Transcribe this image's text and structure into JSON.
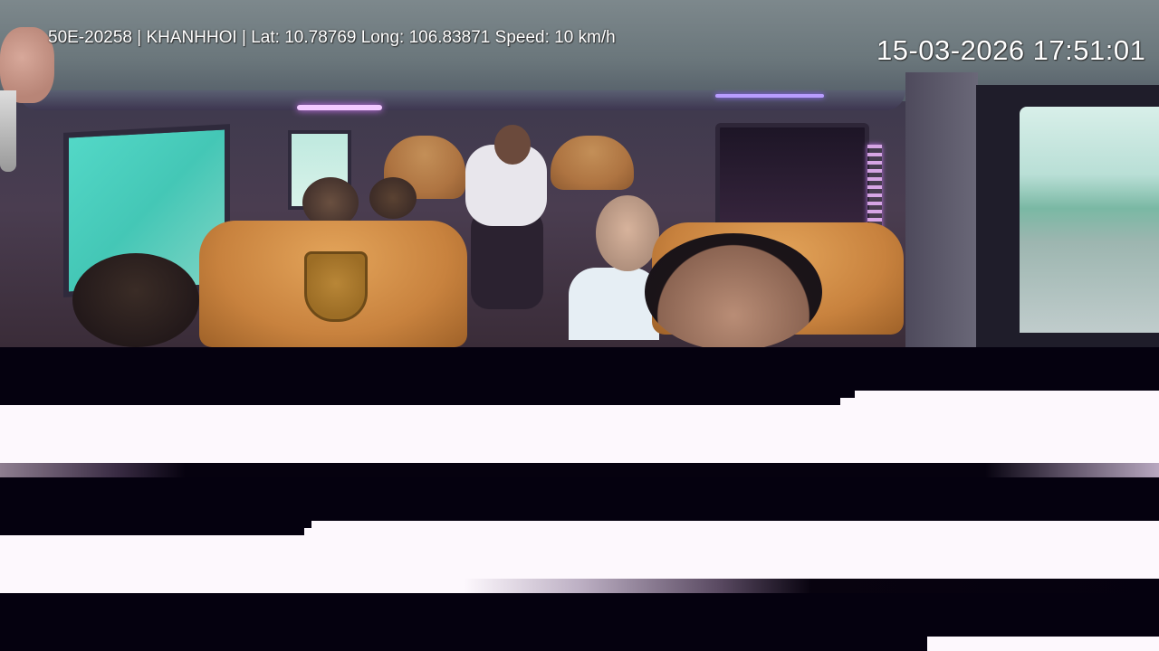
{
  "osd": {
    "info_line": "50E-20258 | KHANHHOI | Lat: 10.78769 Long: 106.83871 Speed: 10 km/h",
    "timestamp": "15-03-2026 17:51:01"
  },
  "colors": {
    "osd_text": "#ffffff",
    "glitch_dark": "#05010f",
    "glitch_light": "#fdf8fd",
    "seat_leather": "#c8823e",
    "ambient_led": "#f0b8ff"
  }
}
